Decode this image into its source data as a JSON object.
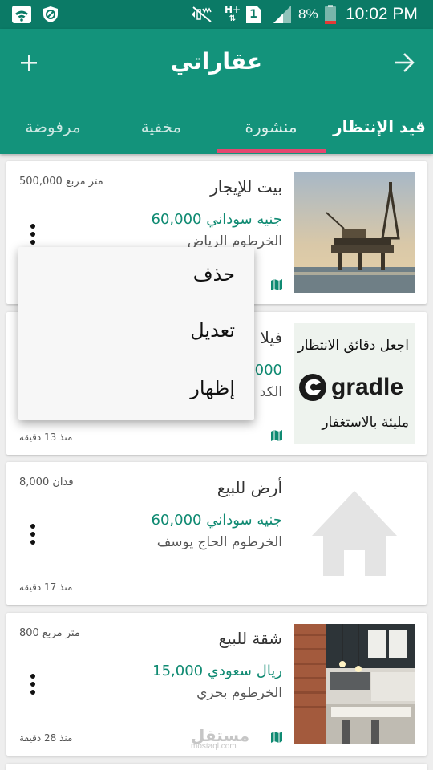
{
  "status_bar": {
    "network_type": "H+",
    "sim_number": "1",
    "battery_percent": "8%",
    "time": "10:02 PM"
  },
  "app_bar": {
    "title": "عقاراتي"
  },
  "tabs": [
    {
      "label": "قيد الإنتظار"
    },
    {
      "label": "منشورة"
    },
    {
      "label": "مخفية"
    },
    {
      "label": "مرفوضة"
    }
  ],
  "active_tab": "منشورة",
  "listings": [
    {
      "title": "بيت للإيجار",
      "price": "60,000 جنيه سوداني",
      "location": "الخرطوم الرياض",
      "area": "500,000 متر مربع",
      "time": "",
      "thumbnail": "oil-platform-photo"
    },
    {
      "title": "فيلا",
      "price": "60,000",
      "location": "الكد",
      "area": "",
      "time": "منذ 13 دقيقة",
      "thumbnail": "gradle-banner"
    },
    {
      "title": "أرض للبيع",
      "price": "60,000 جنيه سوداني",
      "location": "الخرطوم الحاج يوسف",
      "area": "8,000 فدان",
      "time": "منذ 17 دقيقة",
      "thumbnail": "house-placeholder-icon"
    },
    {
      "title": "شقة للبيع",
      "price": "15,000 ريال سعودي",
      "location": "الخرطوم بحري",
      "area": "800 متر مربع",
      "time": "منذ 28 دقيقة",
      "thumbnail": "kitchen-photo"
    }
  ],
  "gradle_banner": {
    "top_text": "اجعل دقائق الانتظار",
    "brand": "gradle",
    "bottom_text": "مليئة بالاستغفار"
  },
  "popup_menu": {
    "items": [
      "حذف",
      "تعديل",
      "إظهار"
    ]
  },
  "watermark": {
    "arabic": "مستقل",
    "latin": "mostaql.com"
  },
  "colors": {
    "status_bar": "#0b7a66",
    "app_bar": "#13937b",
    "tab_indicator": "#e5466f",
    "price_text": "#0f8a72"
  }
}
